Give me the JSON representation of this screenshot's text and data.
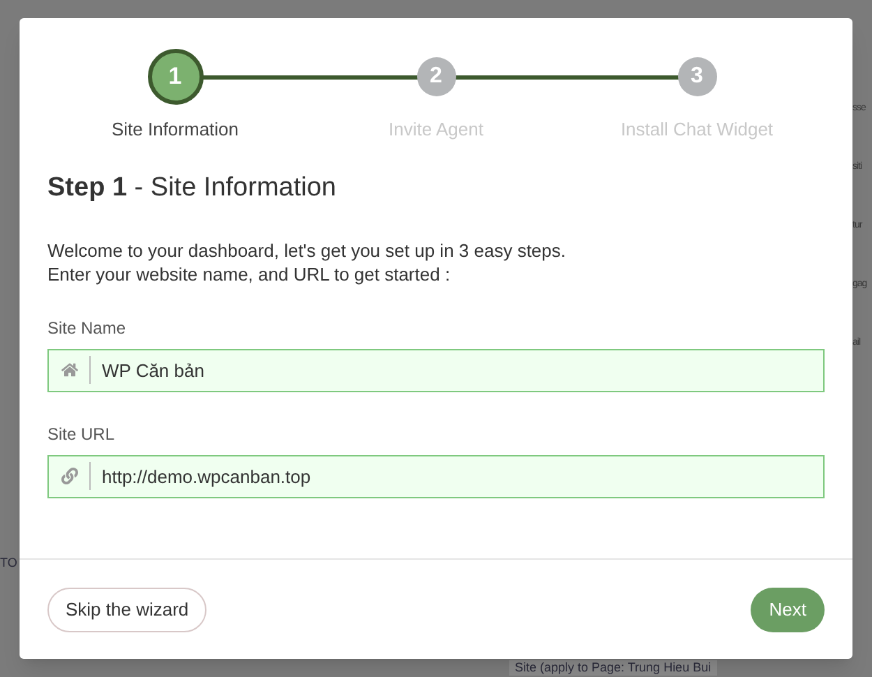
{
  "background": {
    "fragments": [
      "sse",
      "siti",
      "tur",
      "gag",
      "ail"
    ],
    "left_fragment": "TO",
    "bottom_fragment": "Site (apply to Page: Trung Hieu Bui"
  },
  "steps": [
    {
      "number": "1",
      "label": "Site Information",
      "selected": true
    },
    {
      "number": "2",
      "label": "Invite Agent",
      "selected": false
    },
    {
      "number": "3",
      "label": "Install Chat Widget",
      "selected": false
    }
  ],
  "heading": "**Step 1** - Site Information",
  "intro": [
    "Welcome to your dashboard, let's get you set up in 3 easy steps.",
    "Enter your website name, and URL to get started :"
  ],
  "fields": [
    {
      "label": "Site Name",
      "kind": "home",
      "value": "WP Căn bản"
    },
    {
      "label": "Site URL",
      "kind": "link",
      "value": "http://demo.wpcanban.top"
    }
  ],
  "buttons": {
    "skip": "Skip the wizard",
    "next": "Next"
  }
}
